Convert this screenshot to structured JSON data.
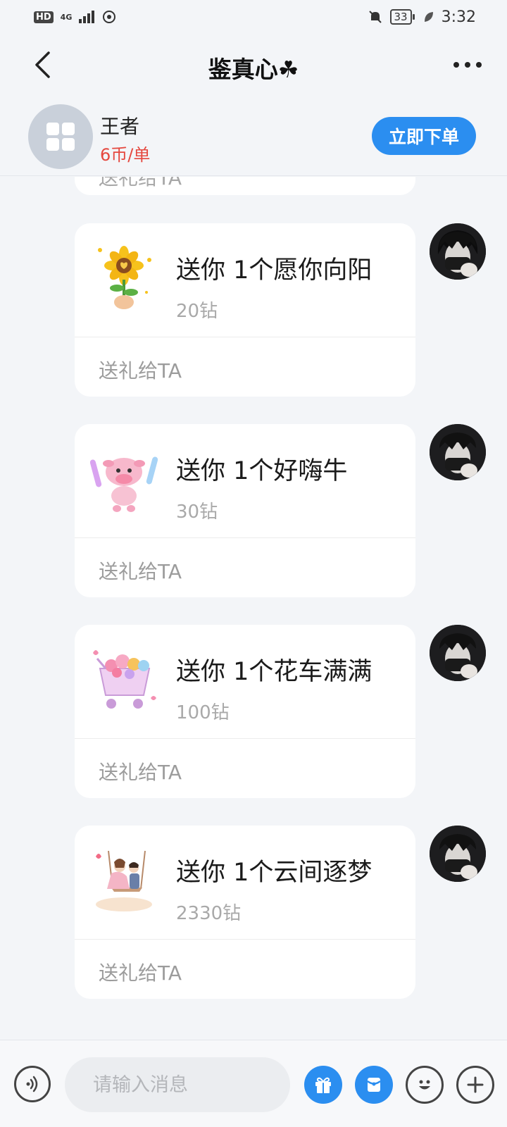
{
  "status_bar": {
    "hd": "HD",
    "network": "4G",
    "battery": "33",
    "time": "3:32"
  },
  "nav": {
    "title": "鉴真心☘"
  },
  "service": {
    "name": "王者",
    "price": "6币/单",
    "order_button": "立即下单"
  },
  "partial_card": {
    "text": "送礼给TA"
  },
  "gifts": [
    {
      "title": "送你 1个愿你向阳",
      "price": "20钻",
      "send_label": "送礼给TA",
      "icon": "sunflower-gift-icon"
    },
    {
      "title": "送你 1个好嗨牛",
      "price": "30钻",
      "send_label": "送礼给TA",
      "icon": "pink-cow-gift-icon"
    },
    {
      "title": "送你 1个花车满满",
      "price": "100钻",
      "send_label": "送礼给TA",
      "icon": "flower-cart-gift-icon"
    },
    {
      "title": "送你 1个云间逐梦",
      "price": "2330钻",
      "send_label": "送礼给TA",
      "icon": "couple-swing-gift-icon"
    }
  ],
  "input_bar": {
    "placeholder": "请输入消息"
  },
  "colors": {
    "accent": "#2b8ef0",
    "price_red": "#e5483f",
    "background": "#f3f5f8"
  }
}
